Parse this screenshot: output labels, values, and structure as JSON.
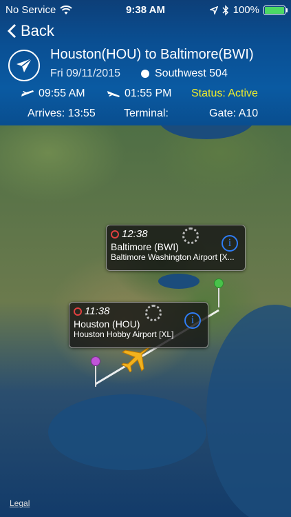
{
  "status_bar": {
    "carrier": "No Service",
    "time": "9:38 AM",
    "battery": "100%",
    "battery_level": 1.0
  },
  "nav": {
    "back_label": "Back"
  },
  "flight": {
    "route": "Houston(HOU) to Baltimore(BWI)",
    "date": "Fri 09/11/2015",
    "airline_flight": "Southwest 504",
    "departure_time": "09:55 AM",
    "arrival_time": "01:55 PM",
    "status": "Status: Active",
    "arrives": "Arrives: 13:55",
    "terminal": "Terminal:",
    "gate": "Gate: A10"
  },
  "map": {
    "bwi": {
      "time": "12:38",
      "name": "Baltimore (BWI)",
      "sub": "Baltimore Washington Airport [X..."
    },
    "hou": {
      "time": "11:38",
      "name": "Houston (HOU)",
      "sub": "Houston Hobby Airport [XL]"
    },
    "legal": "Legal"
  },
  "colors": {
    "header_bg": "#0a4f93",
    "status_active": "#f2ee2a",
    "pin_origin": "#c054d8",
    "pin_dest": "#48c24a",
    "info_blue": "#2f7df6"
  }
}
